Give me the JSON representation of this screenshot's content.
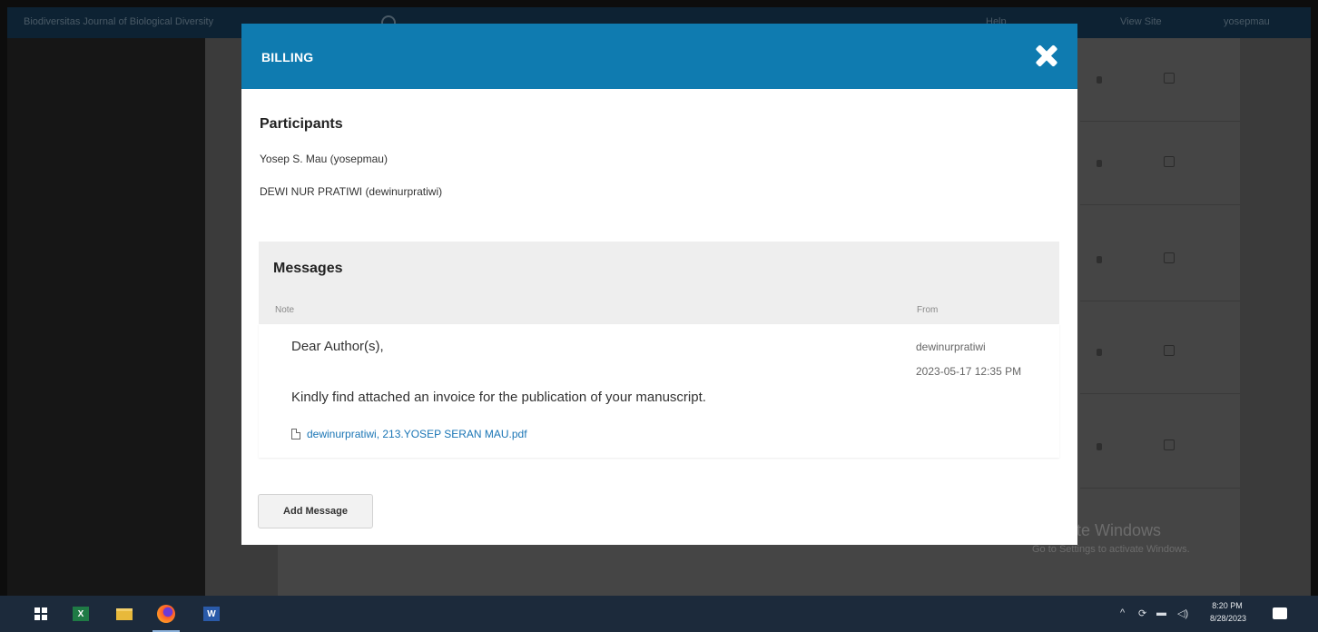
{
  "app": {
    "site_title": "Biodiversitas Journal of Biological Diversity",
    "links": [
      "Help",
      "View Site",
      "yosepmau"
    ]
  },
  "modal": {
    "title": "BILLING",
    "participants_heading": "Participants",
    "participants": [
      "Yosep S. Mau (yosepmau)",
      "DEWI NUR PRATIWI (dewinurpratiwi)"
    ],
    "messages": {
      "title": "Messages",
      "col_note": "Note",
      "col_from": "From",
      "items": [
        {
          "line1": "Dear Author(s),",
          "line2": "Kindly find attached an invoice for the publication of your manuscript.",
          "attachment": "dewinurpratiwi, 213.YOSEP SERAN MAU.pdf",
          "from": "dewinurpratiwi",
          "date": "2023-05-17 12:35 PM"
        }
      ]
    },
    "add_button": "Add Message"
  },
  "watermark": {
    "line1": "Activate Windows",
    "line2": "Go to Settings to activate Windows."
  },
  "taskbar": {
    "time": "8:20 PM",
    "date": "8/28/2023",
    "apps": [
      "windows-icon",
      "excel-icon",
      "file-explorer-icon",
      "firefox-icon",
      "word-icon"
    ]
  }
}
